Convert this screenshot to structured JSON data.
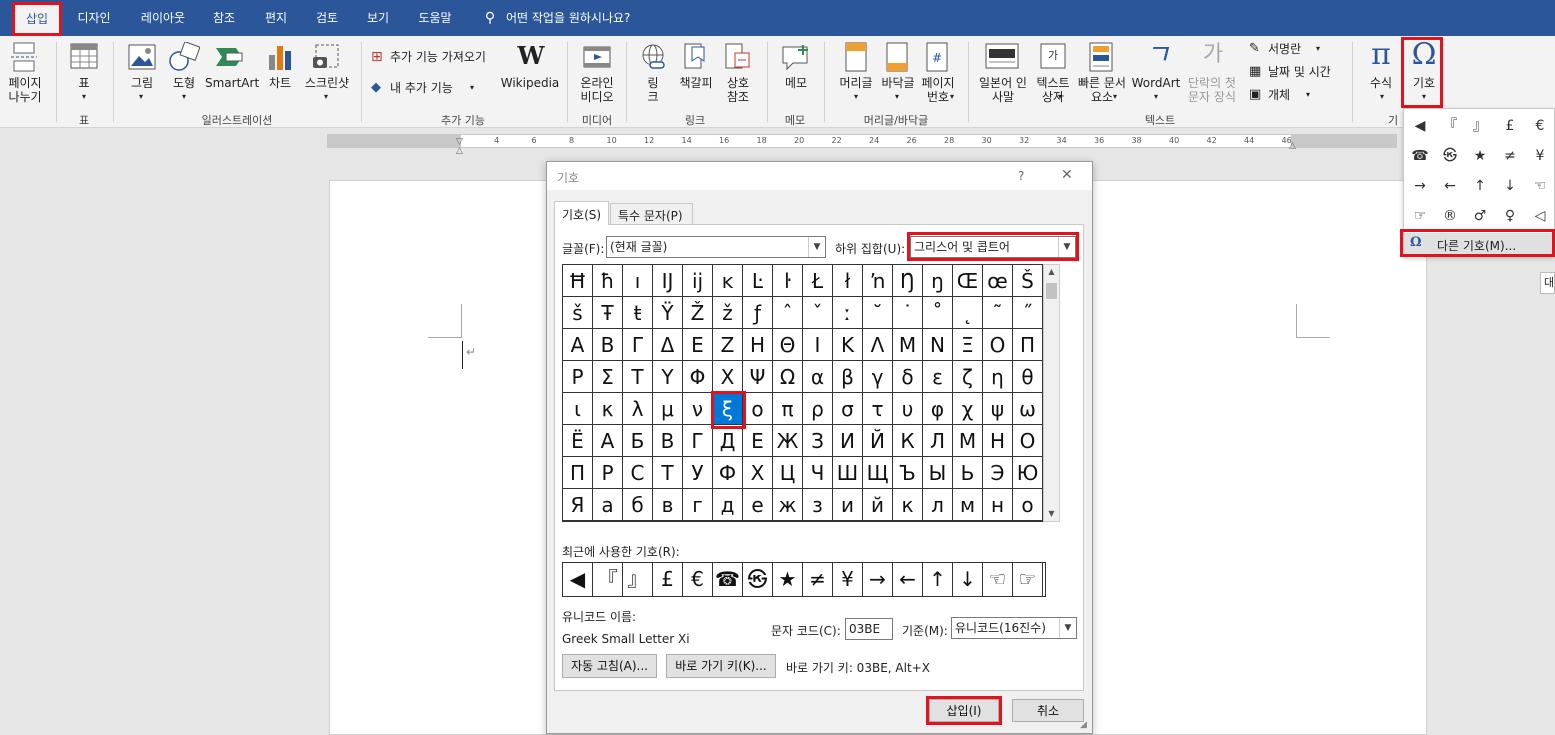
{
  "tabs": [
    "삽입",
    "디자인",
    "레이아웃",
    "참조",
    "편지",
    "검토",
    "보기",
    "도움말"
  ],
  "search": "어떤 작업을 원하시나요?",
  "ribbon": {
    "page_break": "페이지\n나누기",
    "table": "표",
    "picture": "그림",
    "shapes": "도형",
    "smartart": "SmartArt",
    "chart": "차트",
    "screenshot": "스크린샷",
    "get_addins": "추가 기능 가져오기",
    "my_addins": "내 추가 기능",
    "wikipedia": "Wikipedia",
    "online_video": "온라인\n비디오",
    "link": "링\n크",
    "bookmark": "책갈피",
    "crossref": "상호\n참조",
    "comment": "메모",
    "header": "머리글",
    "footer": "바닥글",
    "page_number": "페이지\n번호",
    "japanese": "일본어 인\n사말",
    "textbox": "텍스트\n상자",
    "quickparts": "빠른 문서\n요소",
    "wordart": "WordArt",
    "dropcap": "단락의 첫\n문자 장식",
    "signature": "서명란",
    "datetime": "날짜 및 시간",
    "object": "개체",
    "equation": "수식",
    "symbol": "기호"
  },
  "groups": {
    "table": "표",
    "illustration": "일러스트레이션",
    "addins": "추가 기능",
    "media": "미디어",
    "links": "링크",
    "comments": "메모",
    "headerfooter": "머리글/바닥글",
    "text": "텍스트",
    "symbols": "기"
  },
  "ruler": [
    "6",
    "4",
    "2",
    "2",
    "4",
    "6",
    "8",
    "10",
    "12",
    "14",
    "16",
    "18",
    "20",
    "22",
    "24",
    "26",
    "28",
    "30",
    "32",
    "34",
    "36",
    "38",
    "40",
    "42",
    "44",
    "46",
    "48",
    "50"
  ],
  "symbol_menu": {
    "items": [
      "◀",
      "『",
      "』",
      "£",
      "€",
      "☎",
      "㉿",
      "★",
      "≠",
      "¥",
      "→",
      "←",
      "↑",
      "↓",
      "☜",
      "☞",
      "®",
      "♂",
      "♀",
      "◁"
    ],
    "more": "다른 기호(M)..."
  },
  "side_tip": "대",
  "dialog": {
    "title": "기호",
    "help": "?",
    "close": "✕",
    "tab_symbols": "기호(S)",
    "tab_special": "특수 문자(P)",
    "font_label": "글꼴(F):",
    "font_value": "(현재 글꼴)",
    "subset_label": "하위 집합(U):",
    "subset_value": "그리스어 및 콥트어",
    "grid": [
      [
        "Ħ",
        "ħ",
        "ı",
        "Ĳ",
        "ĳ",
        "ĸ",
        "Ŀ",
        "ŀ",
        "Ł",
        "ł",
        "ŉ",
        "Ŋ",
        "ŋ",
        "Œ",
        "œ",
        "Š"
      ],
      [
        "š",
        "Ŧ",
        "ŧ",
        "Ÿ",
        "Ž",
        "ž",
        "ƒ",
        "ˆ",
        "ˇ",
        "ː",
        "˘",
        "˙",
        "˚",
        "˛",
        "˜",
        "˝"
      ],
      [
        "Α",
        "Β",
        "Γ",
        "Δ",
        "Ε",
        "Ζ",
        "Η",
        "Θ",
        "Ι",
        "Κ",
        "Λ",
        "Μ",
        "Ν",
        "Ξ",
        "Ο",
        "Π"
      ],
      [
        "Ρ",
        "Σ",
        "Τ",
        "Υ",
        "Φ",
        "Χ",
        "Ψ",
        "Ω",
        "α",
        "β",
        "γ",
        "δ",
        "ε",
        "ζ",
        "η",
        "θ"
      ],
      [
        "ι",
        "κ",
        "λ",
        "μ",
        "ν",
        "ξ",
        "ο",
        "π",
        "ρ",
        "σ",
        "τ",
        "υ",
        "φ",
        "χ",
        "ψ",
        "ω"
      ],
      [
        "Ё",
        "А",
        "Б",
        "В",
        "Г",
        "Д",
        "Е",
        "Ж",
        "З",
        "И",
        "Й",
        "К",
        "Л",
        "М",
        "Н",
        "О"
      ],
      [
        "П",
        "Р",
        "С",
        "Т",
        "У",
        "Ф",
        "Х",
        "Ц",
        "Ч",
        "Ш",
        "Щ",
        "Ъ",
        "Ы",
        "Ь",
        "Э",
        "Ю"
      ],
      [
        "Я",
        "а",
        "б",
        "в",
        "г",
        "д",
        "е",
        "ж",
        "з",
        "и",
        "й",
        "к",
        "л",
        "м",
        "н",
        "о"
      ]
    ],
    "recent_label": "최근에 사용한 기호(R):",
    "recent": [
      "◀",
      "『",
      "』",
      "£",
      "€",
      "☎",
      "㉿",
      "★",
      "≠",
      "¥",
      "→",
      "←",
      "↑",
      "↓",
      "☜",
      "☞"
    ],
    "unicode_name_label": "유니코드 이름:",
    "unicode_name": "Greek Small Letter Xi",
    "char_code_label": "문자 코드(C):",
    "char_code": "03BE",
    "from_label": "기준(M):",
    "from_value": "유니코드(16진수)",
    "autocorrect": "자동 고침(A)...",
    "shortcut_key": "바로 가기 키(K)...",
    "shortcut_text": "바로 가기 키: 03BE, Alt+X",
    "insert": "삽입(I)",
    "cancel": "취소"
  },
  "colors": {
    "accent": "#2b579a",
    "highlight": "#e0131e",
    "selection": "#0078d7"
  }
}
